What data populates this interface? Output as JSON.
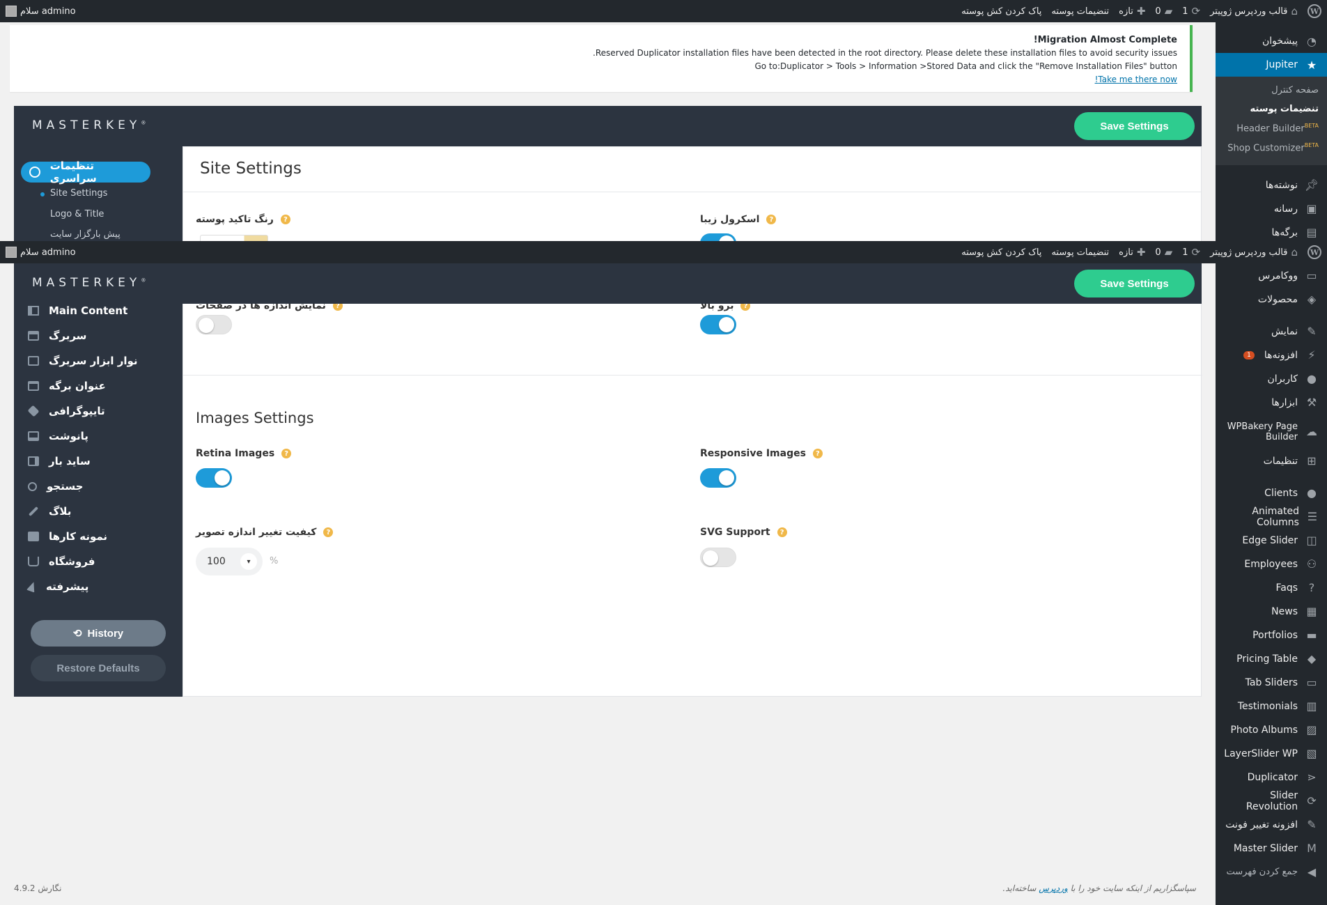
{
  "adminbar": {
    "site_name": "قالب وردپرس ژوپیتر",
    "updates_count": "1",
    "comments_count": "0",
    "new_label": "تازه",
    "post_options": "تنضیمات پوسته",
    "clear_cache": "پاک کردن کش پوسته",
    "greeting": "سلام admino"
  },
  "adminmenu": {
    "dashboard": "پیشخوان",
    "jupiter": "Jupiter",
    "sub": {
      "control_panel": "صفحه کنترل",
      "theme_options": "تنضیمات پوسته",
      "header_builder": "Header Builder",
      "shop_customizer": "Shop Customizer",
      "beta": "BETA"
    },
    "posts": "نوشته‌ها",
    "media": "رسانه",
    "pages": "برگه‌ها",
    "woocommerce": "ووکامرس",
    "products": "محصولات",
    "appearance": "نمایش",
    "plugins": "افزونه‌ها",
    "plugins_badge": "1",
    "users": "کاربران",
    "tools": "ابزارها",
    "wpbakery": "WPBakery Page Builder",
    "settings": "تنظیمات",
    "clients": "Clients",
    "animated_columns": "Animated Columns",
    "edge_slider": "Edge Slider",
    "employees": "Employees",
    "faqs": "Faqs",
    "news": "News",
    "portfolios": "Portfolios",
    "pricing_table": "Pricing Table",
    "tab_sliders": "Tab Sliders",
    "testimonials": "Testimonials",
    "photo_albums": "Photo Albums",
    "layerslider": "LayerSlider WP",
    "duplicator": "Duplicator",
    "slider_revolution": "Slider Revolution",
    "font_plugin": "افزونه تغییر فونت",
    "master_slider": "Master Slider",
    "collapse": "جمع کردن فهرست"
  },
  "notice": {
    "title": "Migration Almost Complete!",
    "line1": "Reserved Duplicator installation files have been detected in the root directory. Please delete these installation files to avoid security issues.",
    "line2": "Go to:Duplicator > Tools > Information >Stored Data and click the \"Remove Installation Files\" button",
    "link": "Take me there now!"
  },
  "masterkey": {
    "logo": "MASTERKEY",
    "logo_mark": "®",
    "save_label": "Save Settings"
  },
  "sidebar_top": {
    "global": "تنظیمات سراسری",
    "site_settings": "Site Settings",
    "logo_title": "Logo & Title",
    "preloader": "پیش بارگزار سایت"
  },
  "sidebar_menu": [
    "Main Content",
    "سربرگ",
    "نوار ابزار سربرگ",
    "عنوان برگه",
    "تایپوگرافی",
    "پانوشت",
    "ساید بار",
    "جستجو",
    "بلاگ",
    "نمونه کارها",
    "فروشگاه",
    "پیشرفته"
  ],
  "sidebar_buttons": {
    "history": "History",
    "restore": "Restore Defaults"
  },
  "content_top": {
    "title": "Site Settings",
    "accent_color": "رنگ تاکید پوسته",
    "smooth_scroll": "اسکرول زیبا"
  },
  "content_bottom": {
    "partial_left": "نمایش اندازه ها در صفحات",
    "partial_right": "برو بالا",
    "images_title": "Images Settings",
    "retina": "Retina Images",
    "responsive": "Responsive Images",
    "quality": "کیفیت تغییر اندازه تصویر",
    "quality_value": "100",
    "quality_unit": "%",
    "quality_arrow": "▾",
    "svg": "SVG Support"
  },
  "footer": {
    "thanks_prefix": "سپاسگزاریم از اینکه سایت خود را با",
    "thanks_link": "وردپرس",
    "thanks_suffix": "ساخته‌اید.",
    "version": "نگارش 4.9.2"
  },
  "colors": {
    "accent": "#1e9bd9",
    "save": "#2ecc8f",
    "panel": "#2c3440",
    "admin": "#23282d"
  }
}
